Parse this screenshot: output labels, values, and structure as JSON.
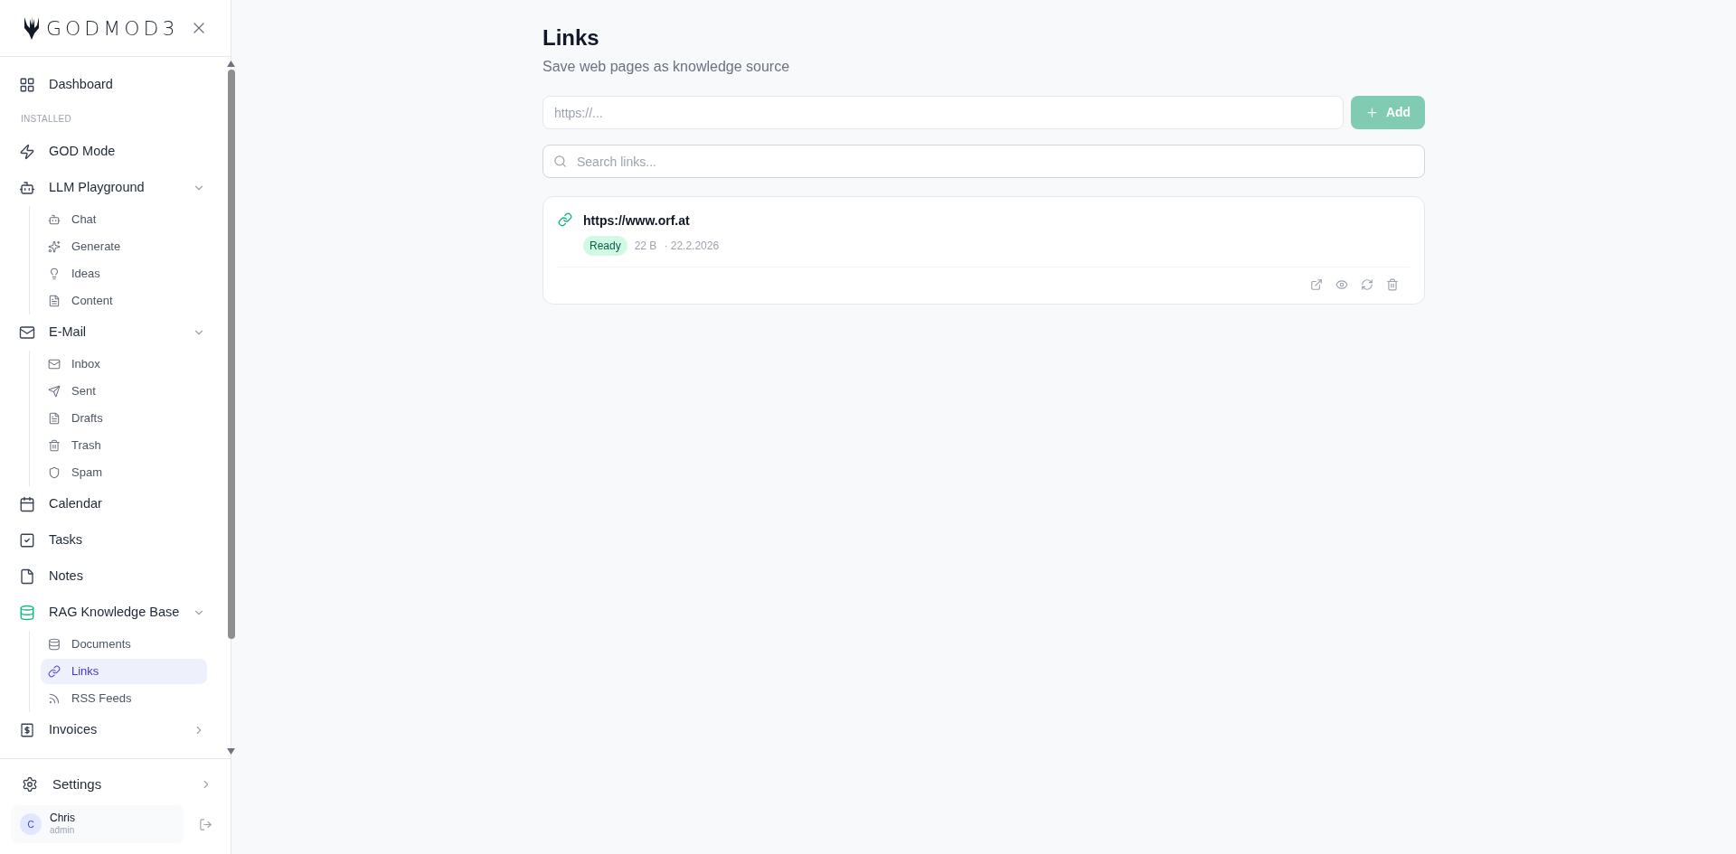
{
  "sidebar": {
    "logo_text": "GODMOD3",
    "nav": [
      {
        "kind": "link",
        "label": "Dashboard",
        "active": false
      },
      {
        "kind": "section",
        "label": "INSTALLED"
      },
      {
        "kind": "link",
        "label": "GOD Mode",
        "active": false
      },
      {
        "kind": "group",
        "label": "LLM Playground",
        "active": false,
        "expanded": true,
        "children": [
          {
            "label": "Chat",
            "selected": false
          },
          {
            "label": "Generate",
            "selected": false
          },
          {
            "label": "Ideas",
            "selected": false
          },
          {
            "label": "Content",
            "selected": false
          }
        ]
      },
      {
        "kind": "group",
        "label": "E-Mail",
        "active": false,
        "expanded": true,
        "children": [
          {
            "label": "Inbox",
            "selected": false
          },
          {
            "label": "Sent",
            "selected": false
          },
          {
            "label": "Drafts",
            "selected": false
          },
          {
            "label": "Trash",
            "selected": false
          },
          {
            "label": "Spam",
            "selected": false
          }
        ]
      },
      {
        "kind": "link",
        "label": "Calendar",
        "active": false
      },
      {
        "kind": "link",
        "label": "Tasks",
        "active": false
      },
      {
        "kind": "link",
        "label": "Notes",
        "active": false
      },
      {
        "kind": "group",
        "label": "RAG Knowledge Base",
        "active": true,
        "expanded": true,
        "children": [
          {
            "label": "Documents",
            "selected": false
          },
          {
            "label": "Links",
            "selected": true
          },
          {
            "label": "RSS Feeds",
            "selected": false
          }
        ]
      },
      {
        "kind": "group",
        "label": "Invoices",
        "active": false,
        "expanded": false
      }
    ],
    "settings": {
      "label": "Settings"
    },
    "user": {
      "initial": "C",
      "name": "Chris",
      "role": "admin"
    }
  },
  "main": {
    "title": "Links",
    "subtitle": "Save web pages as knowledge source",
    "url_field": {
      "placeholder": "https://..."
    },
    "add_button": {
      "label": "Add",
      "disabled": true
    },
    "search": {
      "placeholder": "Search links..."
    },
    "links": [
      {
        "url": "https://www.orf.at",
        "status": {
          "label": "Ready",
          "kind": "ready"
        },
        "size": "22 B",
        "date": "· 22.2.2026"
      }
    ]
  }
}
